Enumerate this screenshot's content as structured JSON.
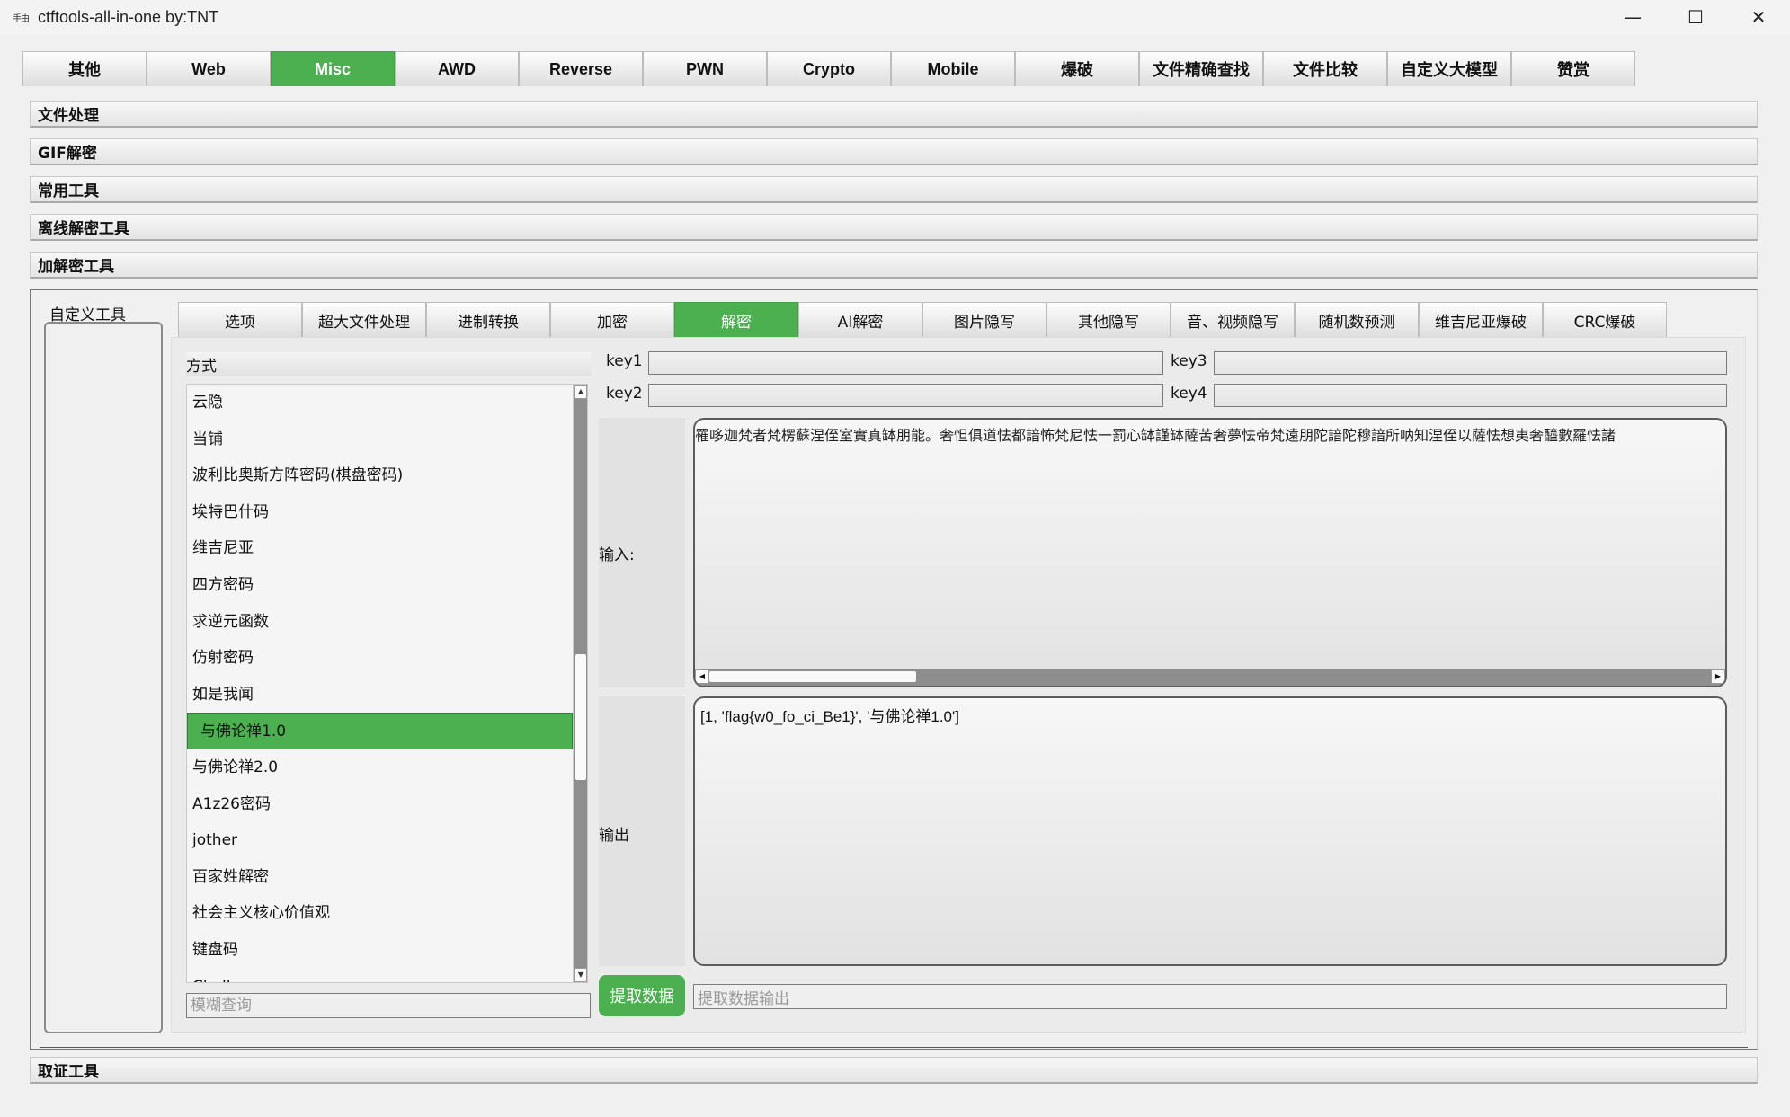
{
  "window": {
    "icon_text": "手由",
    "title": "ctftools-all-in-one   by:TNT",
    "controls": [
      "—",
      "☐",
      "✕"
    ]
  },
  "top_tabs": [
    {
      "label": "其他",
      "active": false
    },
    {
      "label": "Web",
      "active": false
    },
    {
      "label": "Misc",
      "active": true
    },
    {
      "label": "AWD",
      "active": false
    },
    {
      "label": "Reverse",
      "active": false
    },
    {
      "label": "PWN",
      "active": false
    },
    {
      "label": "Crypto",
      "active": false
    },
    {
      "label": "Mobile",
      "active": false
    },
    {
      "label": "爆破",
      "active": false
    },
    {
      "label": "文件精确查找",
      "active": false
    },
    {
      "label": "文件比较",
      "active": false
    },
    {
      "label": "自定义大模型",
      "active": false
    },
    {
      "label": "赞赏",
      "active": false
    }
  ],
  "sections": {
    "file_processing": "文件处理",
    "gif_decrypt": "GIF解密",
    "common_tools": "常用工具",
    "offline_decrypt": "离线解密工具",
    "encrypt_decrypt": "加解密工具",
    "forensics": "取证工具"
  },
  "custom_tools": {
    "label": "自定义工具"
  },
  "inner_tabs": [
    {
      "label": "选项",
      "active": false
    },
    {
      "label": "超大文件处理",
      "active": false
    },
    {
      "label": "进制转换",
      "active": false
    },
    {
      "label": "加密",
      "active": false
    },
    {
      "label": "解密",
      "active": true
    },
    {
      "label": "AI解密",
      "active": false
    },
    {
      "label": "图片隐写",
      "active": false
    },
    {
      "label": "其他隐写",
      "active": false
    },
    {
      "label": "音、视频隐写",
      "active": false
    },
    {
      "label": "随机数预测",
      "active": false
    },
    {
      "label": "维吉尼亚爆破",
      "active": false
    },
    {
      "label": "CRC爆破",
      "active": false
    }
  ],
  "method": {
    "header": "方式",
    "items": [
      "云隐",
      "当铺",
      "波利比奥斯方阵密码(棋盘密码)",
      "埃特巴什码",
      "维吉尼亚",
      "四方密码",
      "求逆元函数",
      "仿射密码",
      "如是我闻",
      "与佛论禅1.0",
      "与佛论禅2.0",
      "A1z26密码",
      "jother",
      "百家姓解密",
      "社会主义核心价值观",
      "键盘码",
      "Challenge"
    ],
    "selected_index": 9,
    "search_placeholder": "模糊查询"
  },
  "keys": {
    "key1": "key1",
    "key2": "key2",
    "key3": "key3",
    "key4": "key4"
  },
  "io": {
    "input_label": "输入:",
    "input_value": "罹哆迦梵者梵楞蘇涅侄室實真缽朋能。奢怛俱道怯都諳怖梵尼怯一罰心缽謹缽薩苦奢夢怯帝梵遠朋陀諳陀穆諳所呐知涅侄以薩怯想夷奢醯數羅怯諸",
    "output_label": "输出",
    "output_value": "[1, 'flag{w0_fo_ci_Be1}', '与佛论禅1.0']"
  },
  "extract": {
    "button_label": "提取数据",
    "output_placeholder": "提取数据输出"
  },
  "colors": {
    "accent": "#4caf50"
  }
}
